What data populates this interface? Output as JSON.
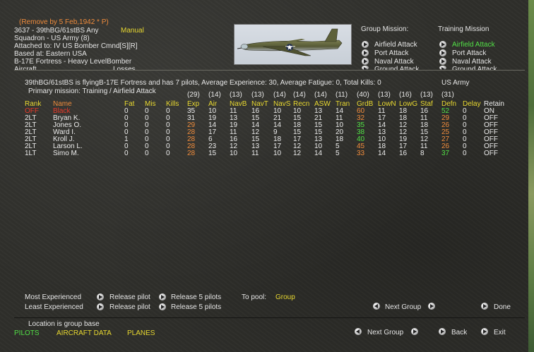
{
  "header": {
    "remove_note": "(Remove by  5 Feb,1942 * P)",
    "unit_line": "3637 - 39thBG/61stBS  Any",
    "mode": "Manual",
    "squadron": "Squadron - US Army (8)",
    "attached": "Attached to:  IV US Bomber Cmnd[S][R]",
    "based": "Based at:  Eastern USA",
    "aircraft_type": "B-17E Fortress - Heavy LevelBomber",
    "cut_left": "Aircraft",
    "cut_right": "Losses"
  },
  "missions": {
    "group_title": "Group Mission:",
    "training_title": "Training Mission",
    "group_items": [
      "Airfield Attack",
      "Port Attack",
      "Naval Attack",
      "Ground Attack"
    ],
    "training_items": [
      "Airfield Attack",
      "Port Attack",
      "Naval Attack",
      "Ground Attack"
    ],
    "training_selected_index": 0
  },
  "summary": {
    "line1": "39thBG/61stBS is flyingB-17E Fortress and has 7 pilots,  Average Experience: 30, Average Fatigue: 0, Total Kills: 0",
    "nation": "US Army",
    "line2": "Primary mission: Training / Airfield Attack"
  },
  "table": {
    "skill_averages": [
      "(29)",
      "(14)",
      "(13)",
      "(13)",
      "(14)",
      "(14)",
      "(14)",
      "(11)",
      "(40)",
      "(13)",
      "(16)",
      "(13)",
      "(31)"
    ],
    "headers": [
      "Rank",
      "Name",
      "Fat",
      "Mis",
      "Kills",
      "Exp",
      "Air",
      "NavB",
      "NavT",
      "NavS",
      "Recn",
      "ASW",
      "Tran",
      "GrdB",
      "LowN",
      "LowG",
      "Staf",
      "Defn",
      "Delay",
      "Retain"
    ],
    "rows": [
      [
        "OFF",
        "Black",
        "0",
        "0",
        "0",
        "35",
        "10",
        "11",
        "16",
        "10",
        "10",
        "13",
        "14",
        "60",
        "11",
        "18",
        "16",
        "52",
        "0",
        "ON"
      ],
      [
        "2LT",
        "Bryan K.",
        "0",
        "0",
        "0",
        "31",
        "19",
        "13",
        "15",
        "21",
        "15",
        "21",
        "11",
        "32",
        "17",
        "18",
        "11",
        "29",
        "0",
        "OFF"
      ],
      [
        "2LT",
        "Jones O.",
        "0",
        "0",
        "0",
        "29",
        "14",
        "19",
        "14",
        "14",
        "18",
        "15",
        "10",
        "35",
        "14",
        "12",
        "18",
        "26",
        "0",
        "OFF"
      ],
      [
        "2LT",
        "Ward I.",
        "0",
        "0",
        "0",
        "28",
        "17",
        "11",
        "12",
        "9",
        "15",
        "15",
        "20",
        "38",
        "13",
        "12",
        "15",
        "25",
        "0",
        "OFF"
      ],
      [
        "2LT",
        "Kroll J.",
        "1",
        "0",
        "0",
        "28",
        "6",
        "16",
        "15",
        "18",
        "17",
        "13",
        "18",
        "40",
        "10",
        "19",
        "12",
        "27",
        "0",
        "OFF"
      ],
      [
        "2LT",
        "Larson L.",
        "0",
        "0",
        "0",
        "28",
        "23",
        "12",
        "13",
        "17",
        "12",
        "10",
        "5",
        "45",
        "18",
        "17",
        "11",
        "26",
        "0",
        "OFF"
      ],
      [
        "1LT",
        "Simo M.",
        "0",
        "0",
        "0",
        "28",
        "15",
        "10",
        "11",
        "10",
        "12",
        "14",
        "5",
        "33",
        "14",
        "16",
        "8",
        "37",
        "0",
        "OFF"
      ]
    ]
  },
  "pool": {
    "most": "Most Experienced",
    "least": "Least Experienced",
    "release1": "Release pilot",
    "release5": "Release 5 pilots",
    "to_pool": "To pool:",
    "pool_value": "Group"
  },
  "nav": {
    "next_group": "Next Group",
    "done": "Done",
    "location": "Location is group base",
    "tab_pilots": "PILOTS",
    "tab_aircraft": "AIRCRAFT DATA",
    "tab_planes": "PLANES",
    "next_group2": "Next Group",
    "back": "Back",
    "exit": "Exit"
  },
  "colors": {
    "orange": "#f08c3c",
    "yellow": "#e8d830",
    "green": "#52e046",
    "red": "#e83a2a",
    "panel": "#2f2f2b"
  }
}
